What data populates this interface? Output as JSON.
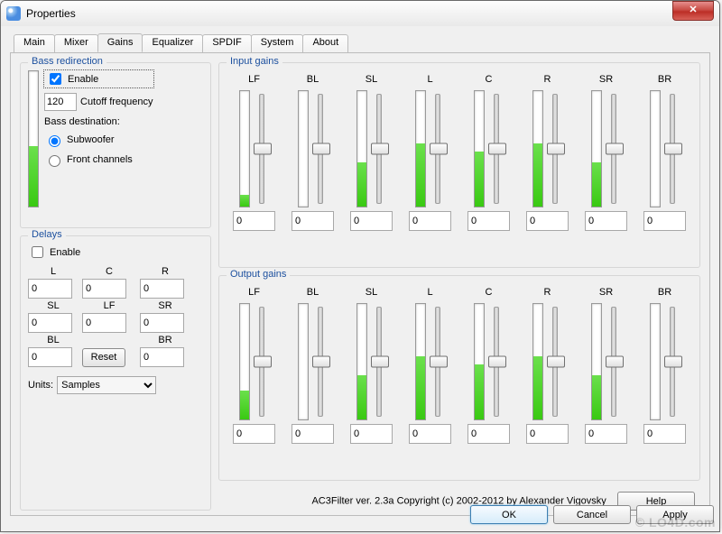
{
  "window": {
    "title": "Properties",
    "close_glyph": "✕"
  },
  "tabs": [
    "Main",
    "Mixer",
    "Gains",
    "Equalizer",
    "SPDIF",
    "System",
    "About"
  ],
  "active_tab": 2,
  "bass": {
    "legend": "Bass redirection",
    "enable_label": "Enable",
    "enable_checked": true,
    "cutoff_value": "120",
    "cutoff_label": "Cutoff frequency",
    "dest_label": "Bass destination:",
    "radio_sub": "Subwoofer",
    "radio_front": "Front channels",
    "radio_selected": "sub",
    "meter_fill_pct": 45
  },
  "delays": {
    "legend": "Delays",
    "enable_label": "Enable",
    "enable_checked": false,
    "labels": {
      "L": "L",
      "C": "C",
      "R": "R",
      "SL": "SL",
      "LF": "LF",
      "SR": "SR",
      "BL": "BL",
      "BR": "BR"
    },
    "values": {
      "L": "0",
      "C": "0",
      "R": "0",
      "SL": "0",
      "LF": "0",
      "SR": "0",
      "BL": "0",
      "BR": "0"
    },
    "reset_label": "Reset",
    "units_label": "Units:",
    "units_value": "Samples"
  },
  "input_gains": {
    "legend": "Input gains",
    "channels": [
      {
        "name": "LF",
        "meter_pct": 10,
        "value": "0"
      },
      {
        "name": "BL",
        "meter_pct": 0,
        "value": "0"
      },
      {
        "name": "SL",
        "meter_pct": 38,
        "value": "0"
      },
      {
        "name": "L",
        "meter_pct": 55,
        "value": "0"
      },
      {
        "name": "C",
        "meter_pct": 48,
        "value": "0"
      },
      {
        "name": "R",
        "meter_pct": 55,
        "value": "0"
      },
      {
        "name": "SR",
        "meter_pct": 38,
        "value": "0"
      },
      {
        "name": "BR",
        "meter_pct": 0,
        "value": "0"
      }
    ]
  },
  "output_gains": {
    "legend": "Output gains",
    "channels": [
      {
        "name": "LF",
        "meter_pct": 25,
        "value": "0"
      },
      {
        "name": "BL",
        "meter_pct": 0,
        "value": "0"
      },
      {
        "name": "SL",
        "meter_pct": 38,
        "value": "0"
      },
      {
        "name": "L",
        "meter_pct": 55,
        "value": "0"
      },
      {
        "name": "C",
        "meter_pct": 48,
        "value": "0"
      },
      {
        "name": "R",
        "meter_pct": 55,
        "value": "0"
      },
      {
        "name": "SR",
        "meter_pct": 38,
        "value": "0"
      },
      {
        "name": "BR",
        "meter_pct": 0,
        "value": "0"
      }
    ]
  },
  "copyright": "AC3Filter ver. 2.3a Copyright (c) 2002-2012 by Alexander Vigovsky",
  "buttons": {
    "help": "Help",
    "ok": "OK",
    "cancel": "Cancel",
    "apply": "Apply"
  },
  "watermark": "© LO4D.com"
}
